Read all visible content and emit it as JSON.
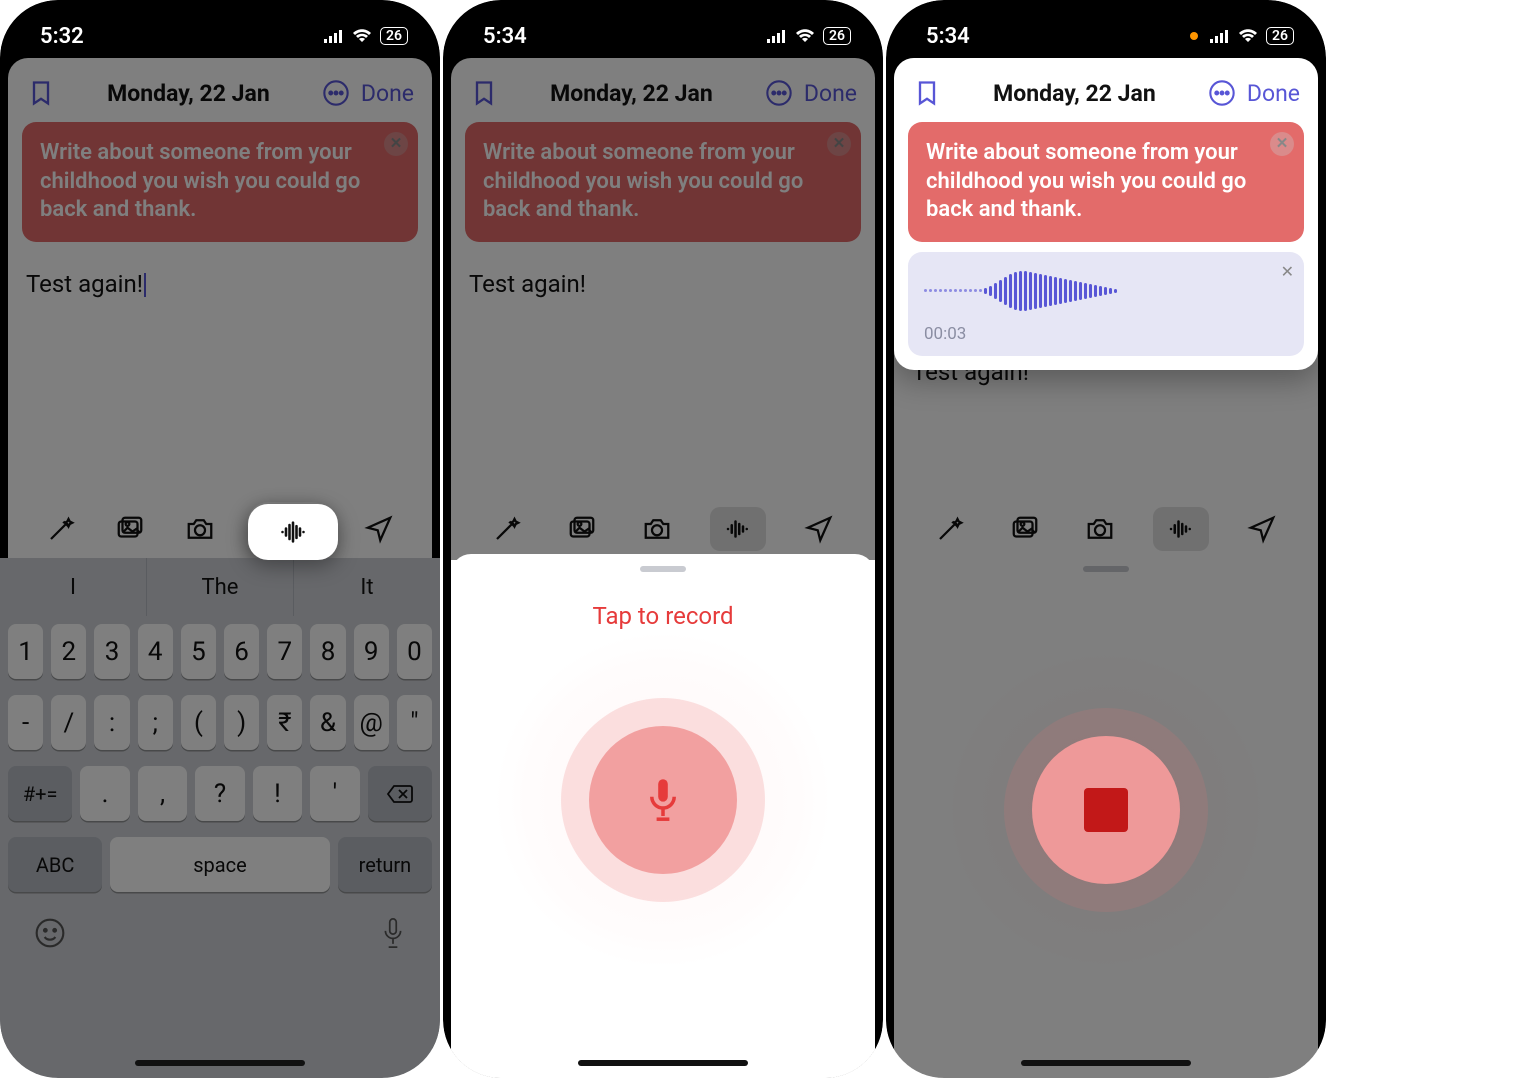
{
  "screens": {
    "s1": {
      "status_time": "5:32",
      "battery": "26",
      "date_title": "Monday, 22 Jan",
      "done_label": "Done",
      "prompt_text": "Write about someone from your childhood you wish you could go back and thank.",
      "entry_text": "Test again!",
      "suggestions": [
        "I",
        "The",
        "It"
      ],
      "keyboard": {
        "row1": [
          "1",
          "2",
          "3",
          "4",
          "5",
          "6",
          "7",
          "8",
          "9",
          "0"
        ],
        "row2": [
          "-",
          "/",
          ":",
          ";",
          "(",
          ")",
          "₹",
          "&",
          "@",
          "\""
        ],
        "row3_switch": "#+=",
        "row3": [
          ".",
          ",",
          "?",
          "!",
          "'"
        ],
        "row3_backspace": "⌫",
        "abc_label": "ABC",
        "space_label": "space",
        "return_label": "return"
      }
    },
    "s2": {
      "status_time": "5:34",
      "battery": "26",
      "date_title": "Monday, 22 Jan",
      "done_label": "Done",
      "prompt_text": "Write about someone from your childhood you wish you could go back and thank.",
      "entry_text": "Test again!",
      "record_label": "Tap to record"
    },
    "s3": {
      "status_time": "5:34",
      "battery": "26",
      "date_title": "Monday, 22 Jan",
      "done_label": "Done",
      "prompt_text": "Write about someone from your childhood you wish you could go back and thank.",
      "audio_duration": "00:03",
      "entry_text": "Test again!"
    }
  },
  "icons_desc": {
    "bookmark": "bookmark outline",
    "more": "ellipsis in circle",
    "magic": "wand with sparkles",
    "gallery": "photo gallery",
    "camera": "camera",
    "audio": "sound wave",
    "location": "paper plane arrow"
  }
}
